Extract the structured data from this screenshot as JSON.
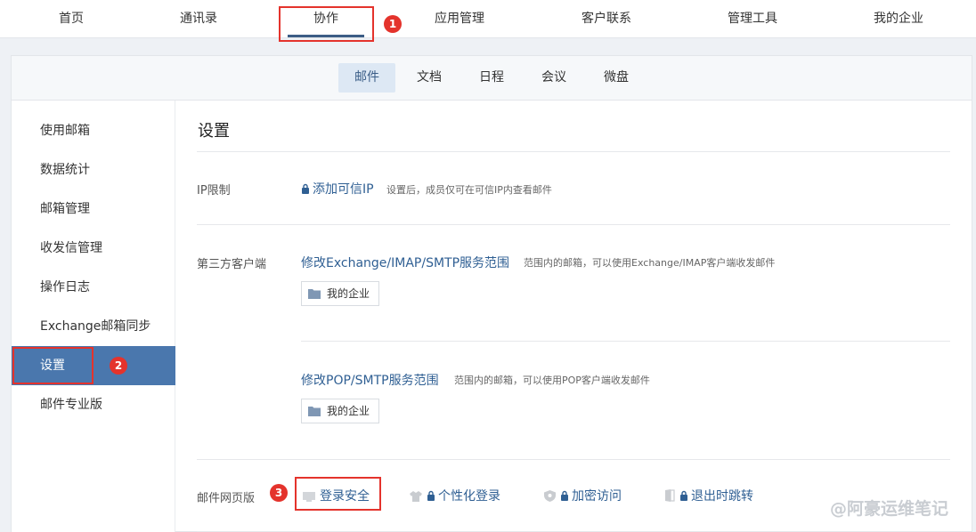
{
  "topnav": {
    "items": [
      "首页",
      "通讯录",
      "协作",
      "应用管理",
      "客户联系",
      "管理工具",
      "我的企业"
    ],
    "active": "协作"
  },
  "annotations": [
    "1",
    "2",
    "3"
  ],
  "subnav": {
    "tabs": [
      "邮件",
      "文档",
      "日程",
      "会议",
      "微盘"
    ],
    "active": "邮件"
  },
  "sidebar": {
    "items": [
      "使用邮箱",
      "数据统计",
      "邮箱管理",
      "收发信管理",
      "操作日志",
      "Exchange邮箱同步",
      "设置",
      "邮件专业版"
    ],
    "active": "设置"
  },
  "main": {
    "title": "设置",
    "ip": {
      "label": "IP限制",
      "link": "添加可信IP",
      "hint": "设置后，成员仅可在可信IP内查看邮件"
    },
    "third_party": {
      "label": "第三方客户端",
      "exchange_link": "修改Exchange/IMAP/SMTP服务范围",
      "exchange_hint": "范围内的邮箱，可以使用Exchange/IMAP客户端收发邮件",
      "exchange_scope": "我的企业",
      "pop_link": "修改POP/SMTP服务范围",
      "pop_hint": "范围内的邮箱，可以使用POP客户端收发邮件",
      "pop_scope": "我的企业"
    },
    "web": {
      "label": "邮件网页版",
      "options": [
        "登录安全",
        "个性化登录",
        "加密访问",
        "退出时跳转"
      ]
    }
  },
  "watermark": "@阿豪运维笔记",
  "colors": {
    "accent": "#4a77ad",
    "link": "#2f5f93",
    "highlight": "#e4332c"
  }
}
